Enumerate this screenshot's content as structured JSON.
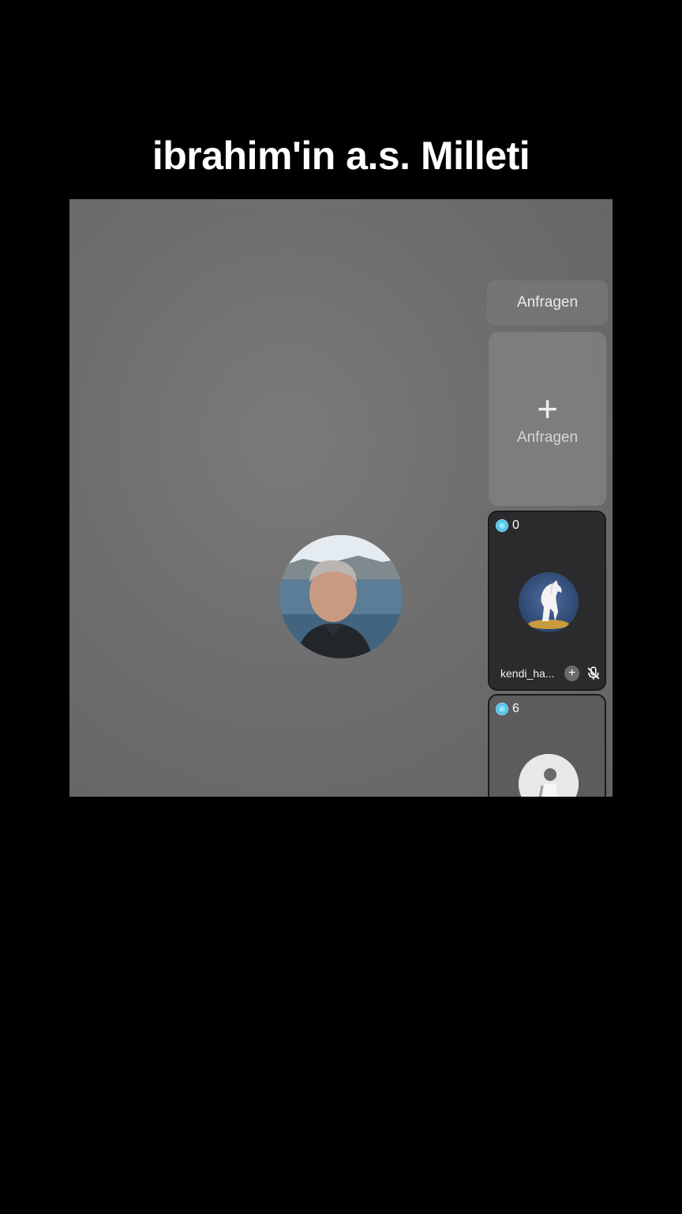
{
  "caption": {
    "text": "ibrahim'in a.s. Milleti"
  },
  "live": {
    "request_button_label": "Anfragen",
    "request_slot": {
      "label": "Anfragen",
      "plus_icon": "plus-icon"
    },
    "guests": [
      {
        "coin_count": "0",
        "name": "kendi_ha...",
        "avatar": "white-horse-avatar"
      },
      {
        "coin_count": "6",
        "avatar": "person-avatar"
      }
    ]
  },
  "colors": {
    "background": "#000000",
    "live_frame": "#6c6c6c",
    "guest_card": "#2b2b2d",
    "coin": "#4cc8f0"
  }
}
